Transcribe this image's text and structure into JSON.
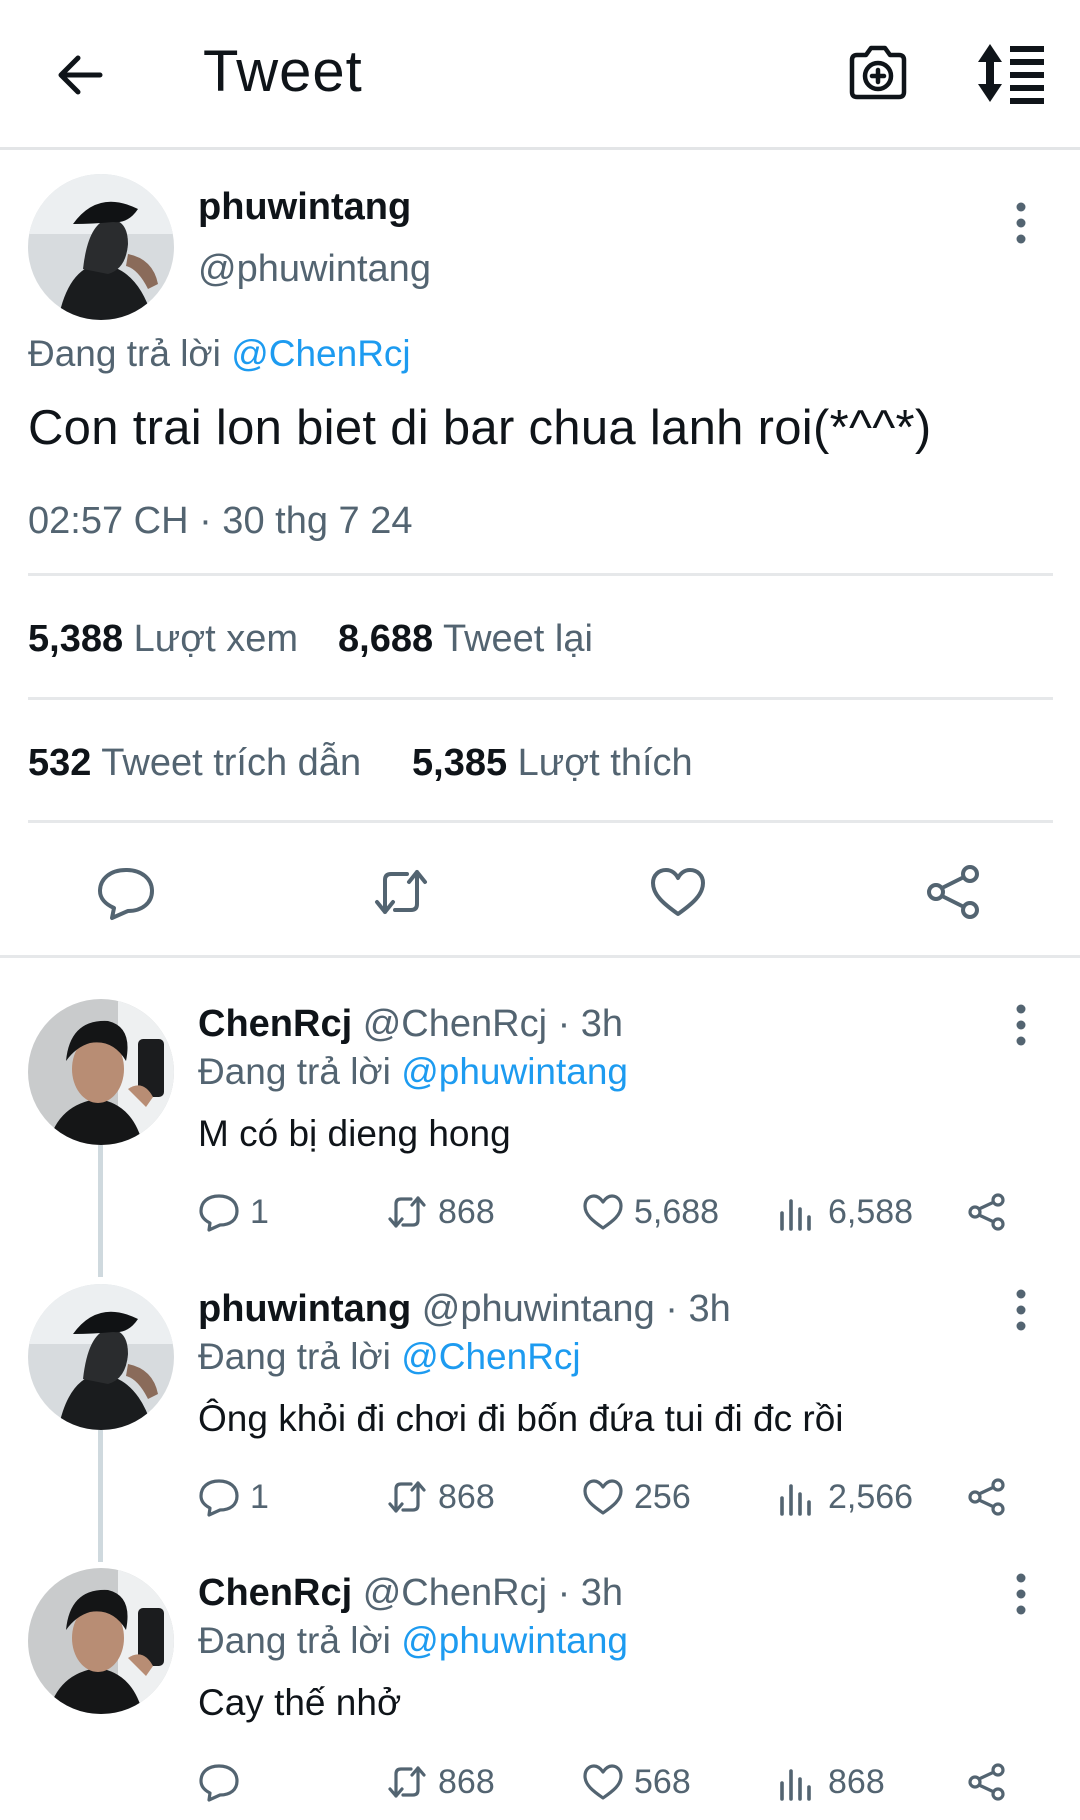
{
  "header": {
    "title": "Tweet",
    "icons": [
      "back-arrow-icon",
      "camera-add-icon",
      "sort-icon"
    ]
  },
  "main_tweet": {
    "author_name": "phuwintang",
    "author_handle": "@phuwintang",
    "replying_prefix": "Đang trả lời",
    "replying_to": "@ChenRcj",
    "text": "Con trai lon biet di bar chua lanh roi(*^^*)",
    "timestamp": "02:57 CH · 30 thg 7 24",
    "stats": {
      "views_count": "5,388",
      "views_label": "Lượt xem",
      "retweets_count": "8,688",
      "retweets_label": "Tweet lại",
      "quotes_count": "532",
      "quotes_label": "Tweet trích dẫn",
      "likes_count": "5,385",
      "likes_label": "Lượt thích"
    },
    "actions": [
      "reply-icon",
      "retweet-icon",
      "like-icon",
      "share-icon"
    ]
  },
  "replies": [
    {
      "name": "ChenRcj",
      "handle": "@ChenRcj · 3h",
      "replying_prefix": "Đang trả lời",
      "replying_to": "@phuwintang",
      "text": "M có bị dieng hong",
      "reply_count": "1",
      "retweet_count": "868",
      "like_count": "5,688",
      "view_count": "6,588"
    },
    {
      "name": "phuwintang",
      "handle": "@phuwintang · 3h",
      "replying_prefix": "Đang trả lời",
      "replying_to": "@ChenRcj",
      "text": "Ông khỏi đi chơi đi bốn đứa tui đi đc rồi",
      "reply_count": "1",
      "retweet_count": "868",
      "like_count": "256",
      "view_count": "2,566"
    },
    {
      "name": "ChenRcj",
      "handle": "@ChenRcj · 3h",
      "replying_prefix": "Đang trả lời",
      "replying_to": "@phuwintang",
      "text": "Cay thế nhở",
      "reply_count": "",
      "retweet_count": "868",
      "like_count": "568",
      "view_count": "868"
    }
  ],
  "colors": {
    "link": "#1d9bf0",
    "secondary_text": "#536471",
    "primary_text": "#0f1419",
    "divider": "#e6e8ea"
  }
}
